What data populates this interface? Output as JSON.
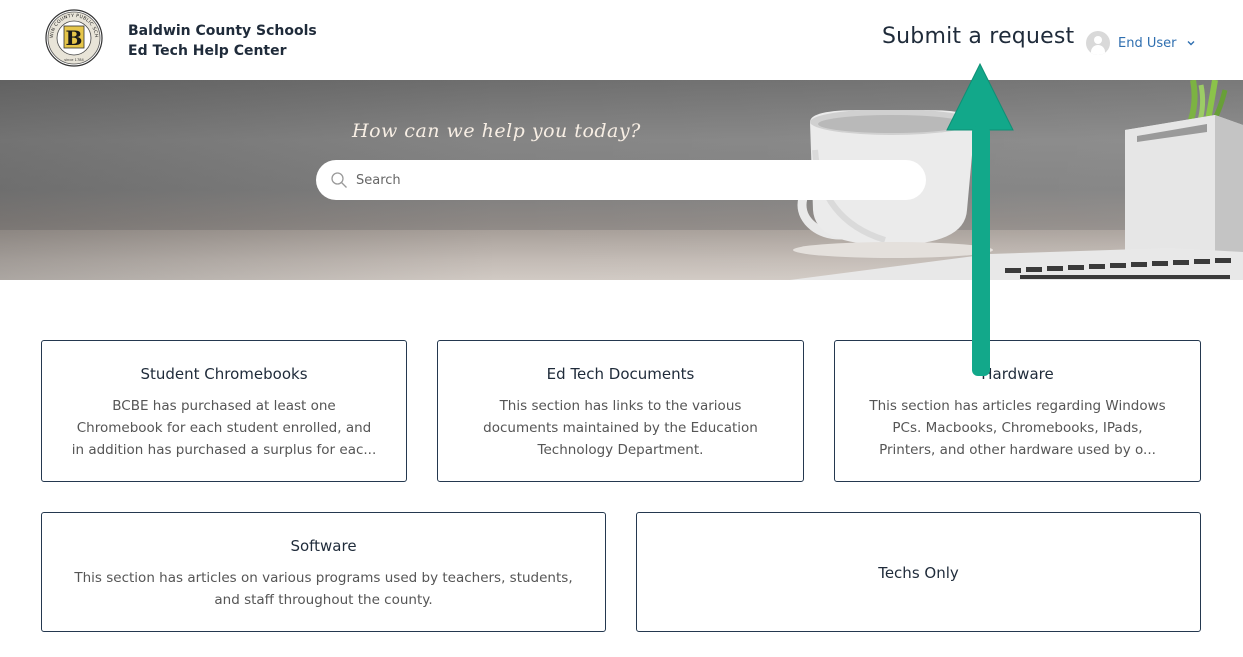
{
  "header": {
    "logo_icon": "school-seal-icon",
    "logo_text": "BALDWIN COUNTY PUBLIC SCHOOLS",
    "logo_letter": "B",
    "logo_since": "since 1784",
    "brand_line1": "Baldwin County Schools",
    "brand_line2": "Ed Tech Help Center",
    "submit_request": "Submit a request",
    "user": {
      "avatar_icon": "user-avatar-icon",
      "name": "End User",
      "chevron_icon": "chevron-down-icon"
    }
  },
  "hero": {
    "title": "How can we help you today?",
    "search": {
      "icon": "search-icon",
      "placeholder": "Search",
      "value": ""
    }
  },
  "categories": [
    {
      "title": "Student Chromebooks",
      "description": "BCBE has purchased at least one Chromebook for each student enrolled, and in addition has purchased a surplus for eac..."
    },
    {
      "title": "Ed Tech Documents",
      "description": "This section has links to the various documents maintained by the Education Technology Department."
    },
    {
      "title": "Hardware",
      "description": "This section has articles regarding Windows PCs. Macbooks, Chromebooks, IPads, Printers, and other hardware used by o..."
    },
    {
      "title": "Software",
      "description": "This section has articles on various programs used by teachers, students, and staff throughout the county."
    },
    {
      "title": "Techs Only",
      "description": ""
    }
  ],
  "annotation": {
    "icon": "arrow-up-icon",
    "color": "#12a88a"
  }
}
